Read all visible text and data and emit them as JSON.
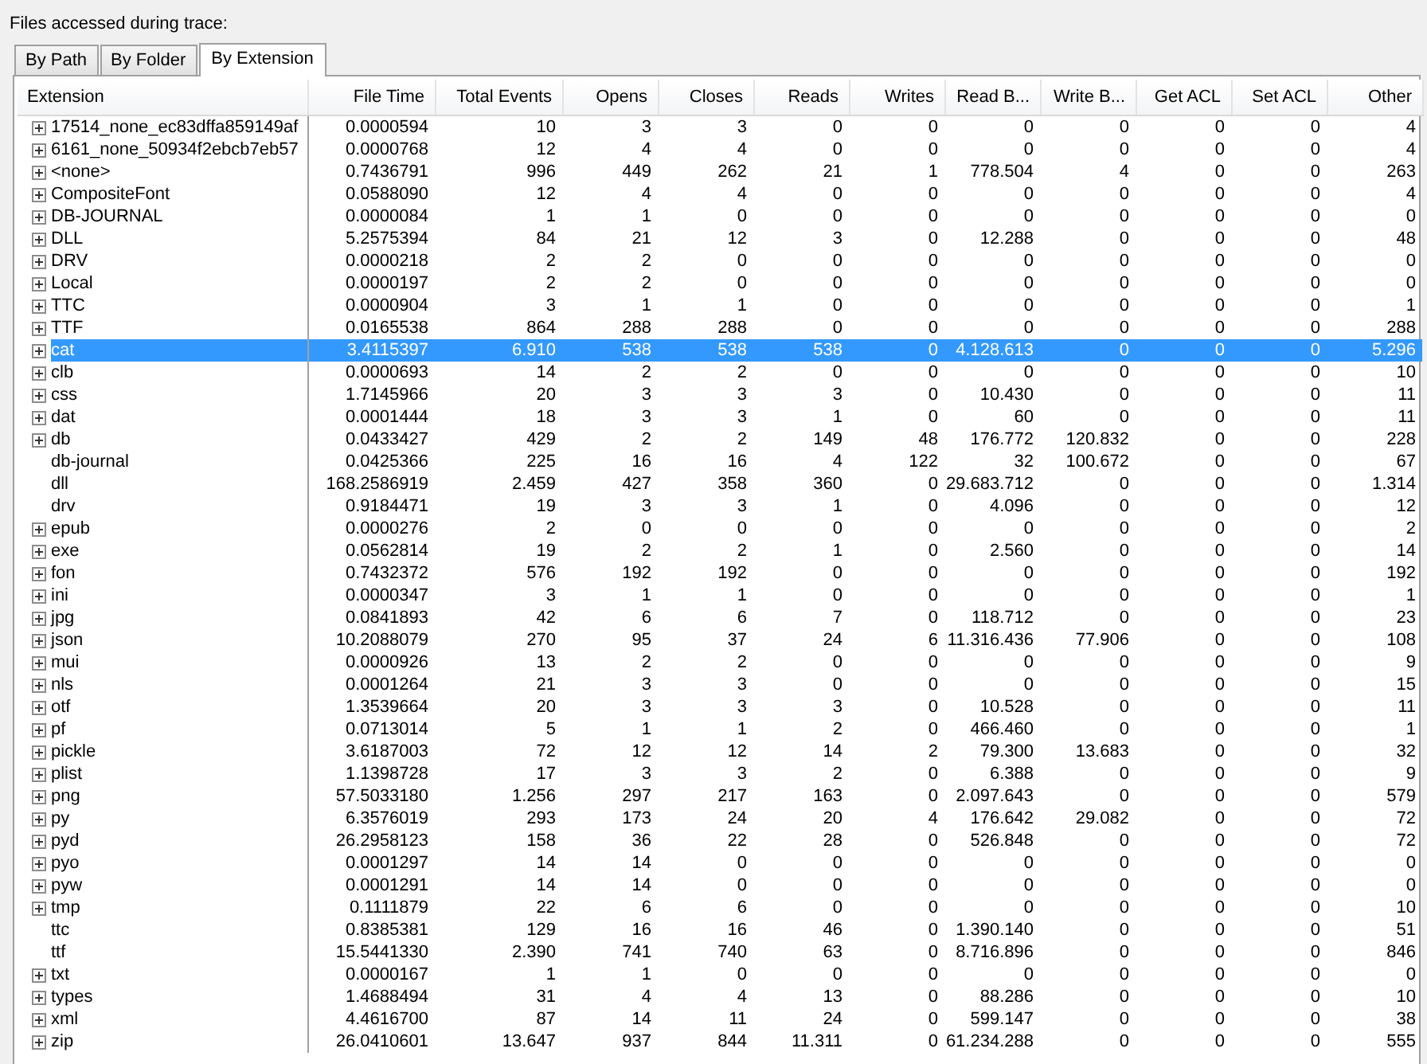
{
  "title": "Files accessed during trace:",
  "tabs": [
    {
      "label": "By Path",
      "selected": false
    },
    {
      "label": "By Folder",
      "selected": false
    },
    {
      "label": "By Extension",
      "selected": true
    }
  ],
  "table": {
    "columns": [
      "Extension",
      "File Time",
      "Total Events",
      "Opens",
      "Closes",
      "Reads",
      "Writes",
      "Read B...",
      "Write B...",
      "Get ACL",
      "Set ACL",
      "Other"
    ],
    "rows": [
      {
        "expandable": true,
        "selected": false,
        "cells": [
          "17514_none_ec83dffa859149af",
          "0.0000594",
          "10",
          "3",
          "3",
          "0",
          "0",
          "0",
          "0",
          "0",
          "0",
          "4"
        ]
      },
      {
        "expandable": true,
        "selected": false,
        "cells": [
          "6161_none_50934f2ebcb7eb57",
          "0.0000768",
          "12",
          "4",
          "4",
          "0",
          "0",
          "0",
          "0",
          "0",
          "0",
          "4"
        ]
      },
      {
        "expandable": true,
        "selected": false,
        "cells": [
          "<none>",
          "0.7436791",
          "996",
          "449",
          "262",
          "21",
          "1",
          "778.504",
          "4",
          "0",
          "0",
          "263"
        ]
      },
      {
        "expandable": true,
        "selected": false,
        "cells": [
          "CompositeFont",
          "0.0588090",
          "12",
          "4",
          "4",
          "0",
          "0",
          "0",
          "0",
          "0",
          "0",
          "4"
        ]
      },
      {
        "expandable": true,
        "selected": false,
        "cells": [
          "DB-JOURNAL",
          "0.0000084",
          "1",
          "1",
          "0",
          "0",
          "0",
          "0",
          "0",
          "0",
          "0",
          "0"
        ]
      },
      {
        "expandable": true,
        "selected": false,
        "cells": [
          "DLL",
          "5.2575394",
          "84",
          "21",
          "12",
          "3",
          "0",
          "12.288",
          "0",
          "0",
          "0",
          "48"
        ]
      },
      {
        "expandable": true,
        "selected": false,
        "cells": [
          "DRV",
          "0.0000218",
          "2",
          "2",
          "0",
          "0",
          "0",
          "0",
          "0",
          "0",
          "0",
          "0"
        ]
      },
      {
        "expandable": true,
        "selected": false,
        "cells": [
          "Local",
          "0.0000197",
          "2",
          "2",
          "0",
          "0",
          "0",
          "0",
          "0",
          "0",
          "0",
          "0"
        ]
      },
      {
        "expandable": true,
        "selected": false,
        "cells": [
          "TTC",
          "0.0000904",
          "3",
          "1",
          "1",
          "0",
          "0",
          "0",
          "0",
          "0",
          "0",
          "1"
        ]
      },
      {
        "expandable": true,
        "selected": false,
        "cells": [
          "TTF",
          "0.0165538",
          "864",
          "288",
          "288",
          "0",
          "0",
          "0",
          "0",
          "0",
          "0",
          "288"
        ]
      },
      {
        "expandable": true,
        "selected": true,
        "cells": [
          "cat",
          "3.4115397",
          "6.910",
          "538",
          "538",
          "538",
          "0",
          "4.128.613",
          "0",
          "0",
          "0",
          "5.296"
        ]
      },
      {
        "expandable": true,
        "selected": false,
        "cells": [
          "clb",
          "0.0000693",
          "14",
          "2",
          "2",
          "0",
          "0",
          "0",
          "0",
          "0",
          "0",
          "10"
        ]
      },
      {
        "expandable": true,
        "selected": false,
        "cells": [
          "css",
          "1.7145966",
          "20",
          "3",
          "3",
          "3",
          "0",
          "10.430",
          "0",
          "0",
          "0",
          "11"
        ]
      },
      {
        "expandable": true,
        "selected": false,
        "cells": [
          "dat",
          "0.0001444",
          "18",
          "3",
          "3",
          "1",
          "0",
          "60",
          "0",
          "0",
          "0",
          "11"
        ]
      },
      {
        "expandable": true,
        "selected": false,
        "cells": [
          "db",
          "0.0433427",
          "429",
          "2",
          "2",
          "149",
          "48",
          "176.772",
          "120.832",
          "0",
          "0",
          "228"
        ]
      },
      {
        "expandable": false,
        "selected": false,
        "cells": [
          "db-journal",
          "0.0425366",
          "225",
          "16",
          "16",
          "4",
          "122",
          "32",
          "100.672",
          "0",
          "0",
          "67"
        ]
      },
      {
        "expandable": false,
        "selected": false,
        "cells": [
          "dll",
          "168.2586919",
          "2.459",
          "427",
          "358",
          "360",
          "0",
          "29.683.712",
          "0",
          "0",
          "0",
          "1.314"
        ]
      },
      {
        "expandable": false,
        "selected": false,
        "cells": [
          "drv",
          "0.9184471",
          "19",
          "3",
          "3",
          "1",
          "0",
          "4.096",
          "0",
          "0",
          "0",
          "12"
        ]
      },
      {
        "expandable": true,
        "selected": false,
        "cells": [
          "epub",
          "0.0000276",
          "2",
          "0",
          "0",
          "0",
          "0",
          "0",
          "0",
          "0",
          "0",
          "2"
        ]
      },
      {
        "expandable": true,
        "selected": false,
        "cells": [
          "exe",
          "0.0562814",
          "19",
          "2",
          "2",
          "1",
          "0",
          "2.560",
          "0",
          "0",
          "0",
          "14"
        ]
      },
      {
        "expandable": true,
        "selected": false,
        "cells": [
          "fon",
          "0.7432372",
          "576",
          "192",
          "192",
          "0",
          "0",
          "0",
          "0",
          "0",
          "0",
          "192"
        ]
      },
      {
        "expandable": true,
        "selected": false,
        "cells": [
          "ini",
          "0.0000347",
          "3",
          "1",
          "1",
          "0",
          "0",
          "0",
          "0",
          "0",
          "0",
          "1"
        ]
      },
      {
        "expandable": true,
        "selected": false,
        "cells": [
          "jpg",
          "0.0841893",
          "42",
          "6",
          "6",
          "7",
          "0",
          "118.712",
          "0",
          "0",
          "0",
          "23"
        ]
      },
      {
        "expandable": true,
        "selected": false,
        "cells": [
          "json",
          "10.2088079",
          "270",
          "95",
          "37",
          "24",
          "6",
          "11.316.436",
          "77.906",
          "0",
          "0",
          "108"
        ]
      },
      {
        "expandable": true,
        "selected": false,
        "cells": [
          "mui",
          "0.0000926",
          "13",
          "2",
          "2",
          "0",
          "0",
          "0",
          "0",
          "0",
          "0",
          "9"
        ]
      },
      {
        "expandable": true,
        "selected": false,
        "cells": [
          "nls",
          "0.0001264",
          "21",
          "3",
          "3",
          "0",
          "0",
          "0",
          "0",
          "0",
          "0",
          "15"
        ]
      },
      {
        "expandable": true,
        "selected": false,
        "cells": [
          "otf",
          "1.3539664",
          "20",
          "3",
          "3",
          "3",
          "0",
          "10.528",
          "0",
          "0",
          "0",
          "11"
        ]
      },
      {
        "expandable": true,
        "selected": false,
        "cells": [
          "pf",
          "0.0713014",
          "5",
          "1",
          "1",
          "2",
          "0",
          "466.460",
          "0",
          "0",
          "0",
          "1"
        ]
      },
      {
        "expandable": true,
        "selected": false,
        "cells": [
          "pickle",
          "3.6187003",
          "72",
          "12",
          "12",
          "14",
          "2",
          "79.300",
          "13.683",
          "0",
          "0",
          "32"
        ]
      },
      {
        "expandable": true,
        "selected": false,
        "cells": [
          "plist",
          "1.1398728",
          "17",
          "3",
          "3",
          "2",
          "0",
          "6.388",
          "0",
          "0",
          "0",
          "9"
        ]
      },
      {
        "expandable": true,
        "selected": false,
        "cells": [
          "png",
          "57.5033180",
          "1.256",
          "297",
          "217",
          "163",
          "0",
          "2.097.643",
          "0",
          "0",
          "0",
          "579"
        ]
      },
      {
        "expandable": true,
        "selected": false,
        "cells": [
          "py",
          "6.3576019",
          "293",
          "173",
          "24",
          "20",
          "4",
          "176.642",
          "29.082",
          "0",
          "0",
          "72"
        ]
      },
      {
        "expandable": true,
        "selected": false,
        "cells": [
          "pyd",
          "26.2958123",
          "158",
          "36",
          "22",
          "28",
          "0",
          "526.848",
          "0",
          "0",
          "0",
          "72"
        ]
      },
      {
        "expandable": true,
        "selected": false,
        "cells": [
          "pyo",
          "0.0001297",
          "14",
          "14",
          "0",
          "0",
          "0",
          "0",
          "0",
          "0",
          "0",
          "0"
        ]
      },
      {
        "expandable": true,
        "selected": false,
        "cells": [
          "pyw",
          "0.0001291",
          "14",
          "14",
          "0",
          "0",
          "0",
          "0",
          "0",
          "0",
          "0",
          "0"
        ]
      },
      {
        "expandable": true,
        "selected": false,
        "cells": [
          "tmp",
          "0.1111879",
          "22",
          "6",
          "6",
          "0",
          "0",
          "0",
          "0",
          "0",
          "0",
          "10"
        ]
      },
      {
        "expandable": false,
        "selected": false,
        "cells": [
          "ttc",
          "0.8385381",
          "129",
          "16",
          "16",
          "46",
          "0",
          "1.390.140",
          "0",
          "0",
          "0",
          "51"
        ]
      },
      {
        "expandable": false,
        "selected": false,
        "cells": [
          "ttf",
          "15.5441330",
          "2.390",
          "741",
          "740",
          "63",
          "0",
          "8.716.896",
          "0",
          "0",
          "0",
          "846"
        ]
      },
      {
        "expandable": true,
        "selected": false,
        "cells": [
          "txt",
          "0.0000167",
          "1",
          "1",
          "0",
          "0",
          "0",
          "0",
          "0",
          "0",
          "0",
          "0"
        ]
      },
      {
        "expandable": true,
        "selected": false,
        "cells": [
          "types",
          "1.4688494",
          "31",
          "4",
          "4",
          "13",
          "0",
          "88.286",
          "0",
          "0",
          "0",
          "10"
        ]
      },
      {
        "expandable": true,
        "selected": false,
        "cells": [
          "xml",
          "4.4616700",
          "87",
          "14",
          "11",
          "24",
          "0",
          "599.147",
          "0",
          "0",
          "0",
          "38"
        ]
      },
      {
        "expandable": true,
        "selected": false,
        "cells": [
          "zip",
          "26.0410601",
          "13.647",
          "937",
          "844",
          "11.311",
          "0",
          "61.234.288",
          "0",
          "0",
          "0",
          "555"
        ]
      }
    ]
  }
}
